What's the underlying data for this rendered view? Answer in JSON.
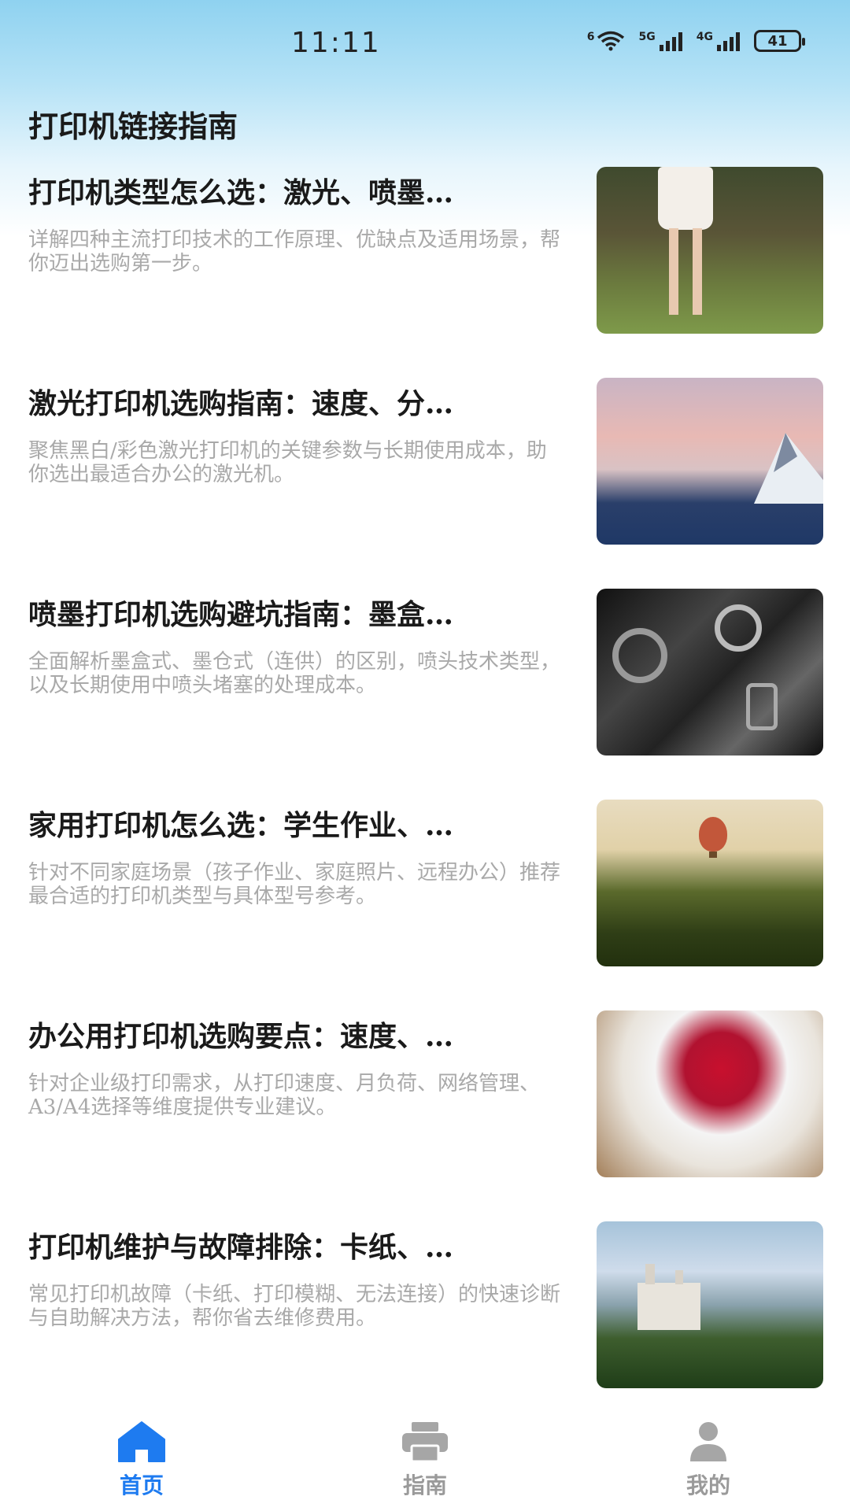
{
  "status_bar": {
    "time": "11:11",
    "wifi_sub": "6",
    "net1": "5G",
    "net2": "4G",
    "battery": "41"
  },
  "header": {
    "title": "打印机链接指南"
  },
  "articles": [
    {
      "title": "打印机类型怎么选：激光、喷墨…",
      "desc": "详解四种主流打印技术的工作原理、优缺点及适用场景，帮你迈出选购第一步。"
    },
    {
      "title": "激光打印机选购指南：速度、分…",
      "desc": "聚焦黑白/彩色激光打印机的关键参数与长期使用成本，助你选出最适合办公的激光机。"
    },
    {
      "title": "喷墨打印机选购避坑指南：墨盒…",
      "desc": "全面解析墨盒式、墨仓式（连供）的区别，喷头技术类型，以及长期使用中喷头堵塞的处理成本。"
    },
    {
      "title": "家用打印机怎么选：学生作业、…",
      "desc": "针对不同家庭场景（孩子作业、家庭照片、远程办公）推荐最合适的打印机类型与具体型号参考。"
    },
    {
      "title": "办公用打印机选购要点：速度、…",
      "desc": "针对企业级打印需求，从打印速度、月负荷、网络管理、A3/A4选择等维度提供专业建议。"
    },
    {
      "title": "打印机维护与故障排除：卡纸、…",
      "desc": "常见打印机故障（卡纸、打印模糊、无法连接）的快速诊断与自助解决方法，帮你省去维修费用。"
    }
  ],
  "bottom_nav": {
    "items": [
      {
        "label": "首页",
        "icon": "home-icon",
        "active": true
      },
      {
        "label": "指南",
        "icon": "printer-icon",
        "active": false
      },
      {
        "label": "我的",
        "icon": "user-icon",
        "active": false
      }
    ]
  },
  "colors": {
    "accent": "#1e7bf0",
    "inactive": "#9a9a9a",
    "description": "#a9a9a9"
  }
}
